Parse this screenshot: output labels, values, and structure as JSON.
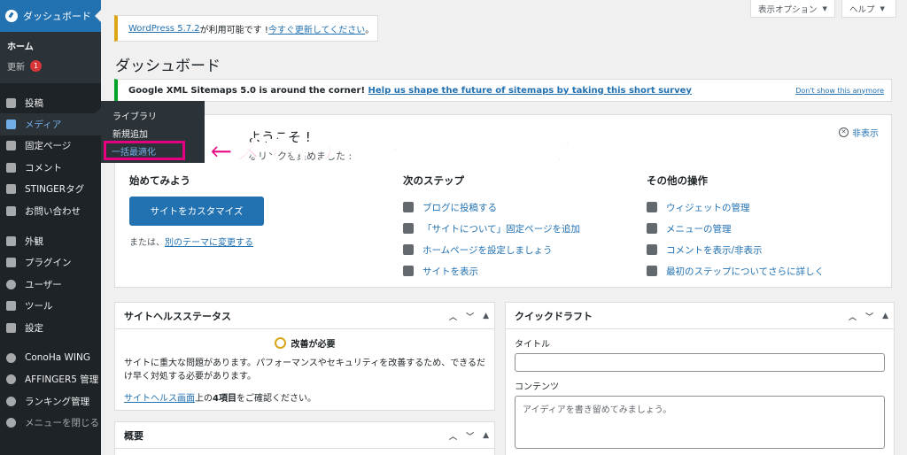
{
  "sidebar": {
    "dashboard": "ダッシュボード",
    "home": "ホーム",
    "updates": "更新",
    "updates_count": "1",
    "items": [
      {
        "label": "投稿",
        "icon": "pin-icon"
      },
      {
        "label": "メディア",
        "icon": "media-icon"
      },
      {
        "label": "固定ページ",
        "icon": "page-icon"
      },
      {
        "label": "コメント",
        "icon": "comment-icon"
      },
      {
        "label": "STINGERタグ",
        "icon": "pin-icon"
      },
      {
        "label": "お問い合わせ",
        "icon": "mail-icon"
      },
      {
        "label": "外観",
        "icon": "brush-icon"
      },
      {
        "label": "プラグイン",
        "icon": "plugin-icon"
      },
      {
        "label": "ユーザー",
        "icon": "user-icon"
      },
      {
        "label": "ツール",
        "icon": "wrench-icon"
      },
      {
        "label": "設定",
        "icon": "settings-icon"
      },
      {
        "label": "ConoHa WING",
        "icon": "gear-icon"
      },
      {
        "label": "AFFINGER5 管理",
        "icon": "gear-icon"
      },
      {
        "label": "ランキング管理",
        "icon": "gear-icon"
      }
    ],
    "collapse": "メニューを閉じる"
  },
  "flyout": {
    "library": "ライブラリ",
    "add_new": "新規追加",
    "bulk_optimize": "一括最適化"
  },
  "topbar": {
    "screen_options": "表示オプション",
    "help": "ヘルプ"
  },
  "notices": {
    "update_link_version": "WordPress 5.7.2",
    "update_text": " が利用可能です ! ",
    "update_now": "今すぐ更新してください",
    "update_end": "。",
    "xml_text": "Google XML Sitemaps 5.0 is around the corner! ",
    "xml_link": "Help us shape the future of sitemaps by taking this short survey",
    "xml_dismiss": "Don't show this anymore"
  },
  "page_title": "ダッシュボード",
  "welcome": {
    "title": "ようこそ !",
    "about": "なリンクを集めました :",
    "dismiss": "非表示",
    "col1_title": "始めてみよう",
    "customize_button": "サイトをカスタマイズ",
    "or_text": "または、",
    "change_theme": "別のテーマに変更する",
    "col2_title": "次のステップ",
    "next_steps": [
      {
        "label": "ブログに投稿する",
        "icon": "edit-icon"
      },
      {
        "label": "「サイトについて」固定ページを追加",
        "icon": "plus-icon"
      },
      {
        "label": "ホームページを設定しましょう",
        "icon": "home-icon"
      },
      {
        "label": "サイトを表示",
        "icon": "view-icon"
      }
    ],
    "col3_title": "その他の操作",
    "more_actions": [
      {
        "label": "ウィジェットの管理",
        "icon": "widgets-icon"
      },
      {
        "label": "メニューの管理",
        "icon": "menu-icon"
      },
      {
        "label": "コメントを表示/非表示",
        "icon": "comment-toggle-icon"
      },
      {
        "label": "最初のステップについてさらに詳しく",
        "icon": "learn-icon"
      }
    ]
  },
  "annotation": "←メディア　＞　一括最適化",
  "site_health": {
    "title": "サイトヘルスステータス",
    "status": "改善が必要",
    "text": "サイトに重大な問題があります。パフォーマンスやセキュリティを改善するため、できるだけ早く対処する必要があります。",
    "link": "サイトヘルス画面",
    "link_after": "上の",
    "items_count": "4項目",
    "link_end": "をご確認ください。"
  },
  "quick_draft": {
    "title": "クイックドラフト",
    "title_label": "タイトル",
    "content_label": "コンテンツ",
    "content_placeholder": "アイディアを書き留めてみましょう。"
  },
  "overview": {
    "title": "概要"
  },
  "colors": {
    "accent": "#2271b1",
    "sidebar": "#1d2327",
    "annotation": "#e5007f",
    "warning": "#dba617",
    "success": "#00a32a"
  }
}
